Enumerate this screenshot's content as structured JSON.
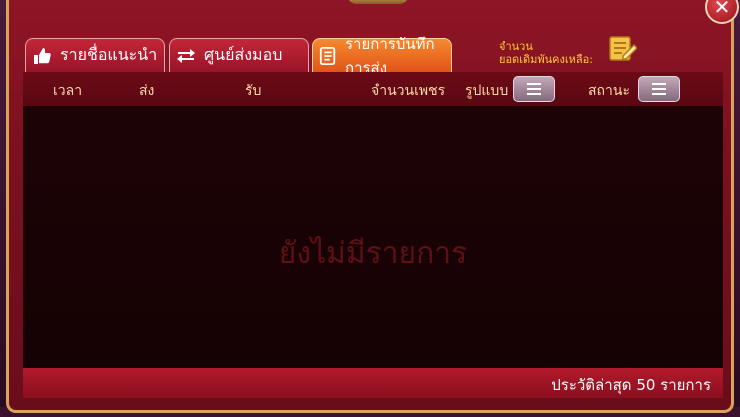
{
  "tabs": [
    {
      "label": "รายชื่อแนะนำ",
      "icon": "thumbs-up-icon"
    },
    {
      "label": "ศูนย์ส่งมอบ",
      "icon": "swap-arrows-icon"
    },
    {
      "label": "รายการบันทึกการส่ง",
      "icon": "document-icon",
      "active": true
    }
  ],
  "balance": {
    "label_line1": "จำนวน",
    "label_line2": "ยอดเดิมพันคงเหลือ:"
  },
  "table": {
    "columns": {
      "time": "เวลา",
      "send": "ส่ง",
      "receive": "รับ",
      "diamonds": "จำนวนเพชร",
      "type": "รูปแบบ",
      "status": "สถานะ"
    }
  },
  "empty_message": "ยังไม่มีรายการ",
  "footer_note": "ประวัติล่าสุด 50 รายการ",
  "colors": {
    "accent_tab": "#f07a2a",
    "panel": "#8e1525",
    "gold": "#ffcc33"
  }
}
